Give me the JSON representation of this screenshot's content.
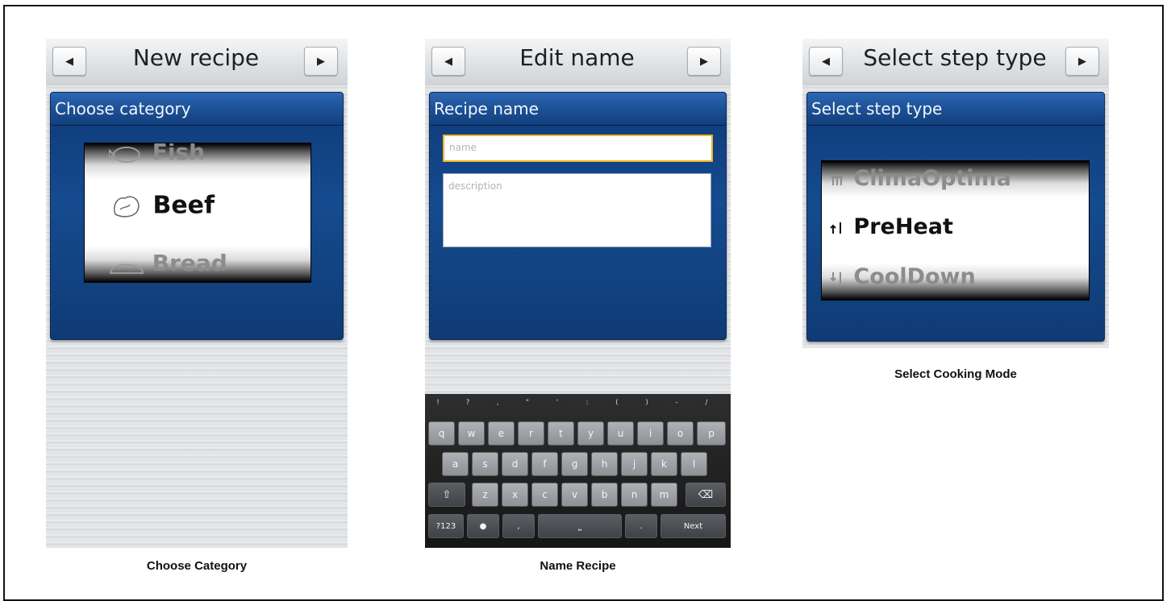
{
  "screens": [
    {
      "title": "New recipe",
      "panel_title": "Choose category",
      "wheel": [
        {
          "label": "Fish",
          "icon": "fish-icon"
        },
        {
          "label": "Beef",
          "icon": "beef-icon"
        },
        {
          "label": "Bread",
          "icon": "bread-icon"
        }
      ],
      "caption": "Choose Category"
    },
    {
      "title": "Edit name",
      "panel_title": "Recipe name",
      "name_placeholder": "name",
      "description_placeholder": "description",
      "caption": "Name Recipe"
    },
    {
      "title": "Select step type",
      "panel_title": "Select step type",
      "wheel": [
        {
          "label": "ClimaOptima",
          "icon": "clima-icon"
        },
        {
          "label": "PreHeat",
          "icon": "preheat-icon"
        },
        {
          "label": "CoolDown",
          "icon": "cooldown-icon"
        }
      ],
      "caption": "Select Cooking Mode"
    }
  ],
  "nav": {
    "prev_glyph": "◀",
    "next_glyph": "▶"
  },
  "keyboard": {
    "symbols": [
      "!",
      "?",
      ",",
      "\"",
      "'",
      ":",
      "(",
      ")",
      "-",
      "/"
    ],
    "row1": [
      "q",
      "w",
      "e",
      "r",
      "t",
      "y",
      "u",
      "i",
      "o",
      "p"
    ],
    "row2": [
      "a",
      "s",
      "d",
      "f",
      "g",
      "h",
      "j",
      "k",
      "l"
    ],
    "row3": [
      "⇧",
      "z",
      "x",
      "c",
      "v",
      "b",
      "n",
      "m",
      "⌫"
    ],
    "row4": {
      "numbers": "?123",
      "mic": "●",
      "comma": ",",
      "space": "⎵",
      "period": ".",
      "next": "Next"
    }
  },
  "colors": {
    "panel_blue": "#154b8f",
    "focus_orange": "#f0b423"
  }
}
